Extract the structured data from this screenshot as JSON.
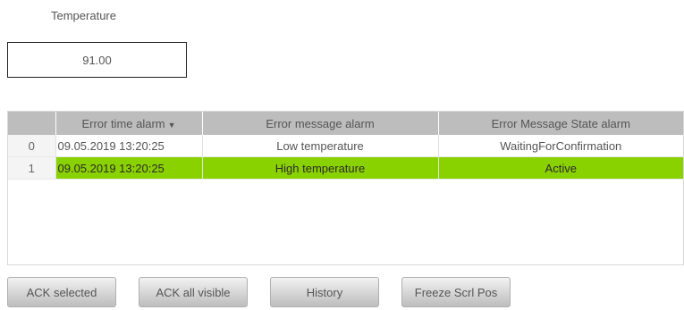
{
  "temperature": {
    "label": "Temperature",
    "value": "91.00"
  },
  "alarm_table": {
    "columns": {
      "index": "",
      "time": "Error time alarm",
      "message": "Error message alarm",
      "state": "Error Message State alarm"
    },
    "sort_column": "time",
    "sort_direction": "descending",
    "rows": [
      {
        "index": "0",
        "time": "09.05.2019 13:20:25",
        "message": "Low temperature",
        "state": "WaitingForConfirmation",
        "highlight": false
      },
      {
        "index": "1",
        "time": "09.05.2019 13:20:25",
        "message": "High temperature",
        "state": "Active",
        "highlight": true,
        "highlight_color": "#8ad100"
      }
    ]
  },
  "buttons": {
    "ack_selected": "ACK selected",
    "ack_all_visible": "ACK all visible",
    "history": "History",
    "freeze_scroll": "Freeze Scrl Pos"
  }
}
